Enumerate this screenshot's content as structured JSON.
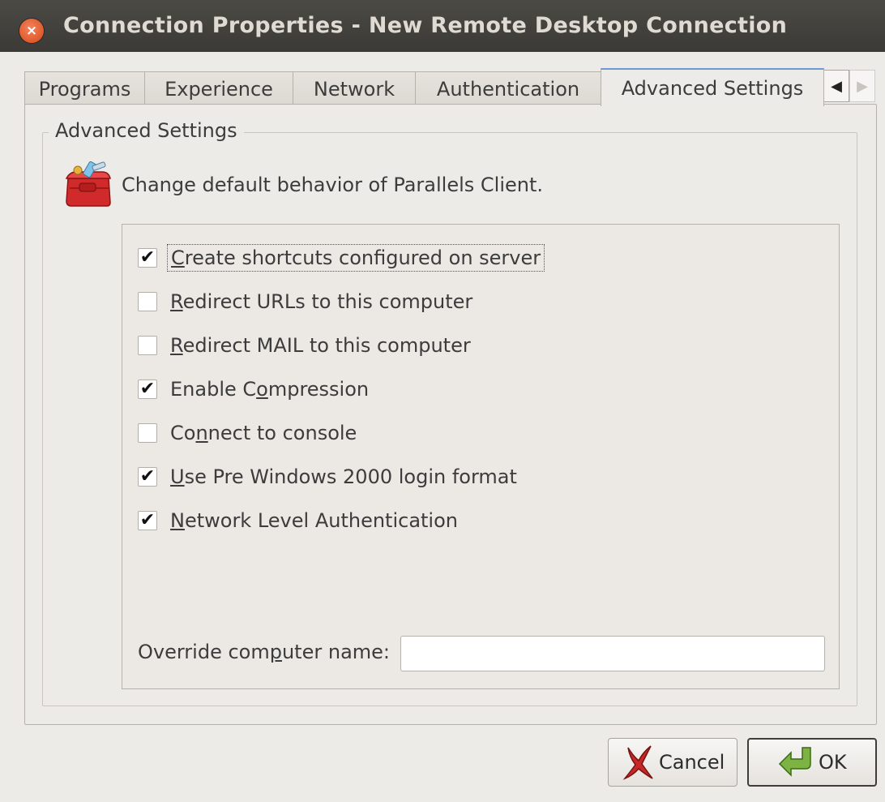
{
  "window": {
    "title": "Connection Properties - New Remote Desktop Connection",
    "close_glyph": "×"
  },
  "tabs": [
    {
      "label": "Programs"
    },
    {
      "label": "Experience"
    },
    {
      "label": "Network"
    },
    {
      "label": "Authentication"
    },
    {
      "label": "Advanced Settings",
      "active": true
    }
  ],
  "tab_scroll": {
    "left": "◀",
    "right": "▶"
  },
  "group": {
    "title": "Advanced Settings",
    "icon": "toolbox-icon",
    "description": "Change default behavior of Parallels Client."
  },
  "options": [
    {
      "pre": "",
      "u": "C",
      "post": "reate shortcuts configured on server",
      "checked": true,
      "mark": "✔"
    },
    {
      "pre": "",
      "u": "R",
      "post": "edirect URLs to this computer",
      "checked": false,
      "mark": ""
    },
    {
      "pre": "",
      "u": "R",
      "post": "edirect MAIL to this computer",
      "checked": false,
      "mark": ""
    },
    {
      "pre": "Enable C",
      "u": "o",
      "post": "mpression",
      "checked": true,
      "mark": "✔"
    },
    {
      "pre": "Co",
      "u": "n",
      "post": "nect to console",
      "checked": false,
      "mark": ""
    },
    {
      "pre": "",
      "u": "U",
      "post": "se Pre Windows 2000 login format",
      "checked": true,
      "mark": "✔"
    },
    {
      "pre": "",
      "u": "N",
      "post": "etwork Level Authentication",
      "checked": true,
      "mark": "✔"
    }
  ],
  "override": {
    "pre": "Override com",
    "u": "p",
    "post": "uter name:",
    "value": ""
  },
  "buttons": {
    "cancel": "Cancel",
    "ok": "OK"
  },
  "colors": {
    "titlebar": "#3b3a36",
    "close": "#e05a2b",
    "active_tab_accent": "#6b9bd1",
    "background": "#edebe7"
  }
}
